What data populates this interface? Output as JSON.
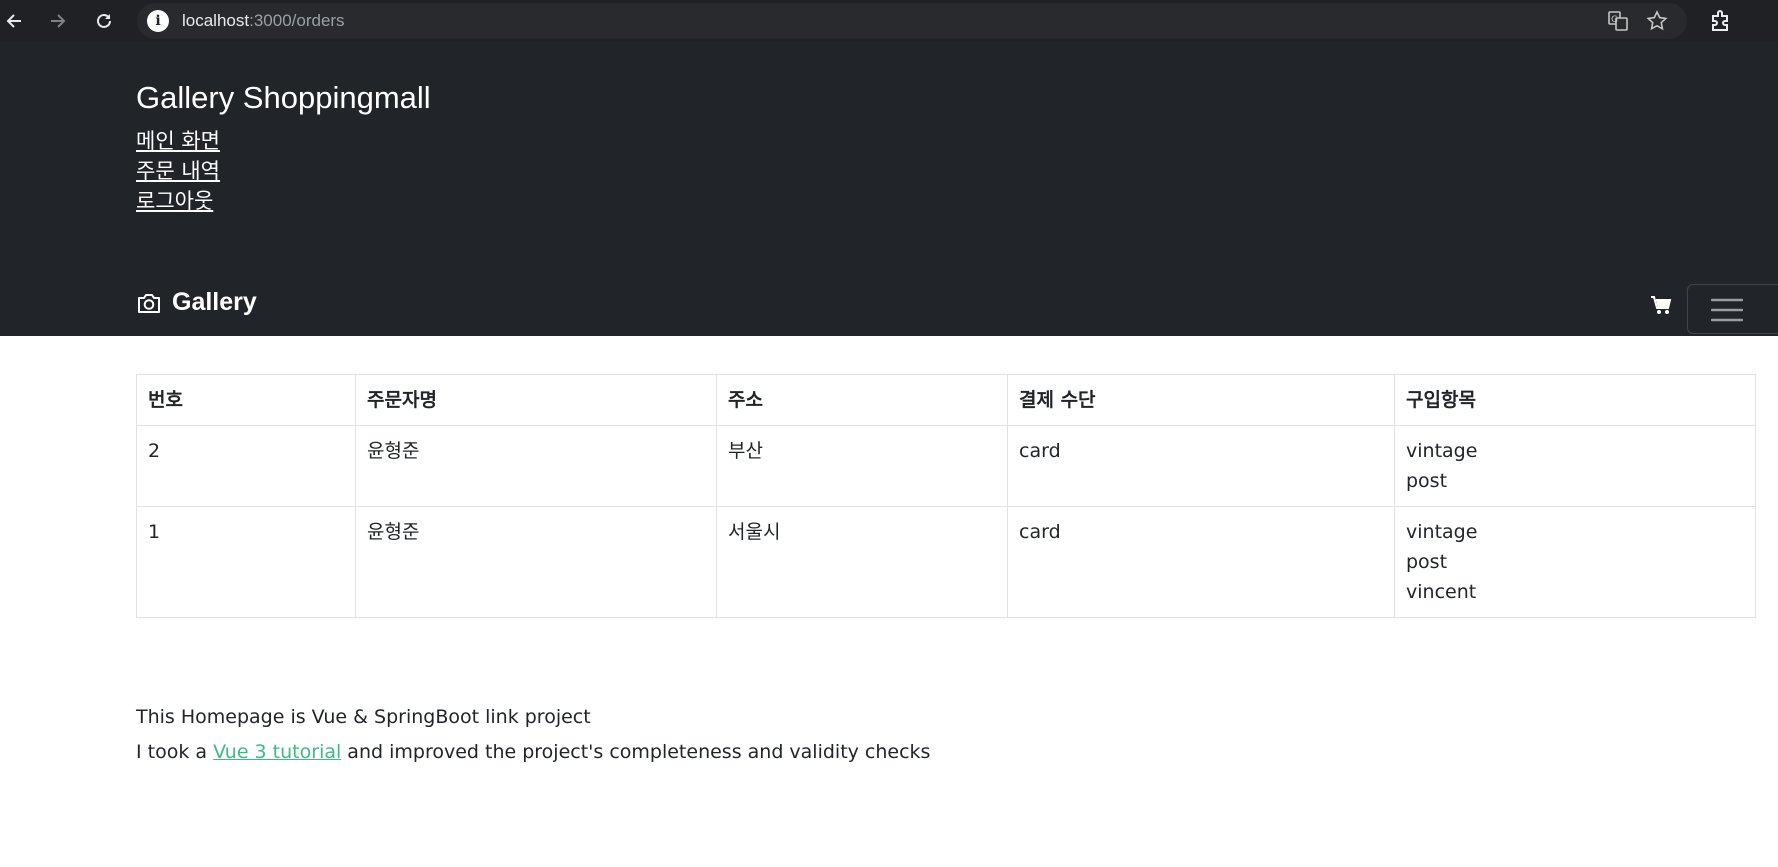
{
  "browser": {
    "url_host": "localhost",
    "url_path": ":3000/orders"
  },
  "header": {
    "site_title": "Gallery Shoppingmall",
    "nav_links": [
      "메인 화면",
      "주문 내역",
      "로그아웃"
    ],
    "brand": "Gallery"
  },
  "orders": {
    "columns": [
      "번호",
      "주문자명",
      "주소",
      "결제 수단",
      "구입항목"
    ],
    "rows": [
      {
        "id": "2",
        "name": "윤형준",
        "address": "부산",
        "payment": "card",
        "items": [
          "vintage",
          "post"
        ]
      },
      {
        "id": "1",
        "name": "윤형준",
        "address": "서울시",
        "payment": "card",
        "items": [
          "vintage",
          "post",
          "vincent"
        ]
      }
    ]
  },
  "footer": {
    "line1": "This Homepage is Vue & SpringBoot link project",
    "line2_prefix": "I took a ",
    "link_label": "Vue 3 tutorial",
    "line2_suffix": " and improved the project's completeness and validity checks",
    "link_color": "#42b983"
  },
  "colors": {
    "header_bg": "#212529",
    "browser_bg": "#202124"
  }
}
